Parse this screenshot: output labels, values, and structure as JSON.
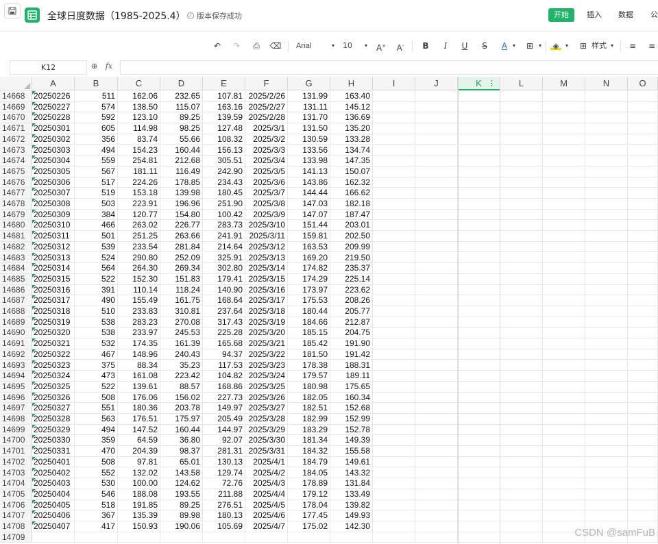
{
  "header": {
    "title": "全球日度数据（1985-2025.4）",
    "save_status": "版本保存成功",
    "menus": [
      "开始",
      "插入",
      "数据",
      "公"
    ]
  },
  "toolbar": {
    "font": "Arial",
    "size": "10",
    "style_label": "样式"
  },
  "formula_bar": {
    "cell_ref": "K12",
    "fx": "fx"
  },
  "columns": [
    "A",
    "B",
    "C",
    "D",
    "E",
    "F",
    "G",
    "H",
    "I",
    "J",
    "K",
    "L",
    "M",
    "N",
    "O"
  ],
  "selected_column": "K",
  "rows": [
    {
      "n": "14668",
      "a": "20250226",
      "b": "511",
      "c": "162.06",
      "d": "232.65",
      "e": "107.81",
      "f": "2025/2/26",
      "g": "131.99",
      "h": "163.40"
    },
    {
      "n": "14669",
      "a": "20250227",
      "b": "574",
      "c": "138.50",
      "d": "115.07",
      "e": "163.16",
      "f": "2025/2/27",
      "g": "131.11",
      "h": "145.12"
    },
    {
      "n": "14670",
      "a": "20250228",
      "b": "592",
      "c": "123.10",
      "d": "89.25",
      "e": "139.59",
      "f": "2025/2/28",
      "g": "131.70",
      "h": "136.69"
    },
    {
      "n": "14671",
      "a": "20250301",
      "b": "605",
      "c": "114.98",
      "d": "98.25",
      "e": "127.48",
      "f": "2025/3/1",
      "g": "131.50",
      "h": "135.20"
    },
    {
      "n": "14672",
      "a": "20250302",
      "b": "356",
      "c": "83.74",
      "d": "55.66",
      "e": "108.32",
      "f": "2025/3/2",
      "g": "130.59",
      "h": "133.28"
    },
    {
      "n": "14673",
      "a": "20250303",
      "b": "494",
      "c": "154.23",
      "d": "160.44",
      "e": "156.13",
      "f": "2025/3/3",
      "g": "133.56",
      "h": "134.74"
    },
    {
      "n": "14674",
      "a": "20250304",
      "b": "559",
      "c": "254.81",
      "d": "212.68",
      "e": "305.51",
      "f": "2025/3/4",
      "g": "133.98",
      "h": "147.35"
    },
    {
      "n": "14675",
      "a": "20250305",
      "b": "567",
      "c": "181.11",
      "d": "116.49",
      "e": "242.90",
      "f": "2025/3/5",
      "g": "141.13",
      "h": "150.07"
    },
    {
      "n": "14676",
      "a": "20250306",
      "b": "517",
      "c": "224.26",
      "d": "178.85",
      "e": "234.43",
      "f": "2025/3/6",
      "g": "143.86",
      "h": "162.32"
    },
    {
      "n": "14677",
      "a": "20250307",
      "b": "519",
      "c": "153.18",
      "d": "139.98",
      "e": "180.45",
      "f": "2025/3/7",
      "g": "144.44",
      "h": "166.62"
    },
    {
      "n": "14678",
      "a": "20250308",
      "b": "503",
      "c": "223.91",
      "d": "196.96",
      "e": "251.90",
      "f": "2025/3/8",
      "g": "147.03",
      "h": "182.18"
    },
    {
      "n": "14679",
      "a": "20250309",
      "b": "384",
      "c": "120.77",
      "d": "154.80",
      "e": "100.42",
      "f": "2025/3/9",
      "g": "147.07",
      "h": "187.47"
    },
    {
      "n": "14680",
      "a": "20250310",
      "b": "466",
      "c": "263.02",
      "d": "226.77",
      "e": "283.73",
      "f": "2025/3/10",
      "g": "151.44",
      "h": "203.01"
    },
    {
      "n": "14681",
      "a": "20250311",
      "b": "501",
      "c": "251.25",
      "d": "263.66",
      "e": "241.91",
      "f": "2025/3/11",
      "g": "159.81",
      "h": "202.50"
    },
    {
      "n": "14682",
      "a": "20250312",
      "b": "539",
      "c": "233.54",
      "d": "281.84",
      "e": "214.64",
      "f": "2025/3/12",
      "g": "163.53",
      "h": "209.99"
    },
    {
      "n": "14683",
      "a": "20250313",
      "b": "524",
      "c": "290.80",
      "d": "252.09",
      "e": "325.91",
      "f": "2025/3/13",
      "g": "169.20",
      "h": "219.50"
    },
    {
      "n": "14684",
      "a": "20250314",
      "b": "564",
      "c": "264.30",
      "d": "269.34",
      "e": "302.80",
      "f": "2025/3/14",
      "g": "174.82",
      "h": "235.37"
    },
    {
      "n": "14685",
      "a": "20250315",
      "b": "522",
      "c": "152.30",
      "d": "151.83",
      "e": "179.41",
      "f": "2025/3/15",
      "g": "174.29",
      "h": "225.14"
    },
    {
      "n": "14686",
      "a": "20250316",
      "b": "391",
      "c": "110.14",
      "d": "118.24",
      "e": "140.90",
      "f": "2025/3/16",
      "g": "173.97",
      "h": "223.62"
    },
    {
      "n": "14687",
      "a": "20250317",
      "b": "490",
      "c": "155.49",
      "d": "161.75",
      "e": "168.64",
      "f": "2025/3/17",
      "g": "175.53",
      "h": "208.26"
    },
    {
      "n": "14688",
      "a": "20250318",
      "b": "510",
      "c": "233.83",
      "d": "310.81",
      "e": "237.64",
      "f": "2025/3/18",
      "g": "180.44",
      "h": "205.77"
    },
    {
      "n": "14689",
      "a": "20250319",
      "b": "538",
      "c": "283.23",
      "d": "270.08",
      "e": "317.43",
      "f": "2025/3/19",
      "g": "184.66",
      "h": "212.87"
    },
    {
      "n": "14690",
      "a": "20250320",
      "b": "538",
      "c": "233.97",
      "d": "245.53",
      "e": "225.28",
      "f": "2025/3/20",
      "g": "185.15",
      "h": "204.75"
    },
    {
      "n": "14691",
      "a": "20250321",
      "b": "532",
      "c": "174.35",
      "d": "161.39",
      "e": "165.68",
      "f": "2025/3/21",
      "g": "185.42",
      "h": "191.90"
    },
    {
      "n": "14692",
      "a": "20250322",
      "b": "467",
      "c": "148.96",
      "d": "240.43",
      "e": "94.37",
      "f": "2025/3/22",
      "g": "181.50",
      "h": "191.42"
    },
    {
      "n": "14693",
      "a": "20250323",
      "b": "375",
      "c": "88.34",
      "d": "35.23",
      "e": "117.53",
      "f": "2025/3/23",
      "g": "178.38",
      "h": "188.31"
    },
    {
      "n": "14694",
      "a": "20250324",
      "b": "473",
      "c": "161.08",
      "d": "223.42",
      "e": "104.82",
      "f": "2025/3/24",
      "g": "179.57",
      "h": "189.11"
    },
    {
      "n": "14695",
      "a": "20250325",
      "b": "522",
      "c": "139.61",
      "d": "88.57",
      "e": "168.86",
      "f": "2025/3/25",
      "g": "180.98",
      "h": "175.65"
    },
    {
      "n": "14696",
      "a": "20250326",
      "b": "508",
      "c": "176.06",
      "d": "156.02",
      "e": "227.73",
      "f": "2025/3/26",
      "g": "182.05",
      "h": "160.34"
    },
    {
      "n": "14697",
      "a": "20250327",
      "b": "551",
      "c": "180.36",
      "d": "203.78",
      "e": "149.97",
      "f": "2025/3/27",
      "g": "182.51",
      "h": "152.68"
    },
    {
      "n": "14698",
      "a": "20250328",
      "b": "563",
      "c": "176.51",
      "d": "175.97",
      "e": "205.49",
      "f": "2025/3/28",
      "g": "182.99",
      "h": "152.99"
    },
    {
      "n": "14699",
      "a": "20250329",
      "b": "494",
      "c": "147.52",
      "d": "160.44",
      "e": "144.97",
      "f": "2025/3/29",
      "g": "183.29",
      "h": "152.78"
    },
    {
      "n": "14700",
      "a": "20250330",
      "b": "359",
      "c": "64.59",
      "d": "36.80",
      "e": "92.07",
      "f": "2025/3/30",
      "g": "181.34",
      "h": "149.39"
    },
    {
      "n": "14701",
      "a": "20250331",
      "b": "470",
      "c": "204.39",
      "d": "98.37",
      "e": "281.31",
      "f": "2025/3/31",
      "g": "184.32",
      "h": "155.58"
    },
    {
      "n": "14702",
      "a": "20250401",
      "b": "508",
      "c": "97.81",
      "d": "65.01",
      "e": "130.13",
      "f": "2025/4/1",
      "g": "184.79",
      "h": "149.61"
    },
    {
      "n": "14703",
      "a": "20250402",
      "b": "552",
      "c": "132.02",
      "d": "143.58",
      "e": "129.74",
      "f": "2025/4/2",
      "g": "184.05",
      "h": "143.32"
    },
    {
      "n": "14704",
      "a": "20250403",
      "b": "530",
      "c": "100.00",
      "d": "124.62",
      "e": "72.76",
      "f": "2025/4/3",
      "g": "178.89",
      "h": "131.84"
    },
    {
      "n": "14705",
      "a": "20250404",
      "b": "546",
      "c": "188.08",
      "d": "193.55",
      "e": "211.88",
      "f": "2025/4/4",
      "g": "179.12",
      "h": "133.49"
    },
    {
      "n": "14706",
      "a": "20250405",
      "b": "518",
      "c": "191.85",
      "d": "89.25",
      "e": "276.51",
      "f": "2025/4/5",
      "g": "178.04",
      "h": "139.82"
    },
    {
      "n": "14707",
      "a": "20250406",
      "b": "367",
      "c": "135.39",
      "d": "89.98",
      "e": "180.13",
      "f": "2025/4/6",
      "g": "177.45",
      "h": "149.93"
    },
    {
      "n": "14708",
      "a": "20250407",
      "b": "417",
      "c": "150.93",
      "d": "190.06",
      "e": "105.69",
      "f": "2025/4/7",
      "g": "175.02",
      "h": "142.30"
    },
    {
      "n": "14709",
      "a": "",
      "b": "",
      "c": "",
      "d": "",
      "e": "",
      "f": "",
      "g": "",
      "h": ""
    }
  ],
  "watermark": "CSDN @samFuB",
  "colors": {
    "accent": "#21b26b",
    "flag": "#1f9d55"
  }
}
